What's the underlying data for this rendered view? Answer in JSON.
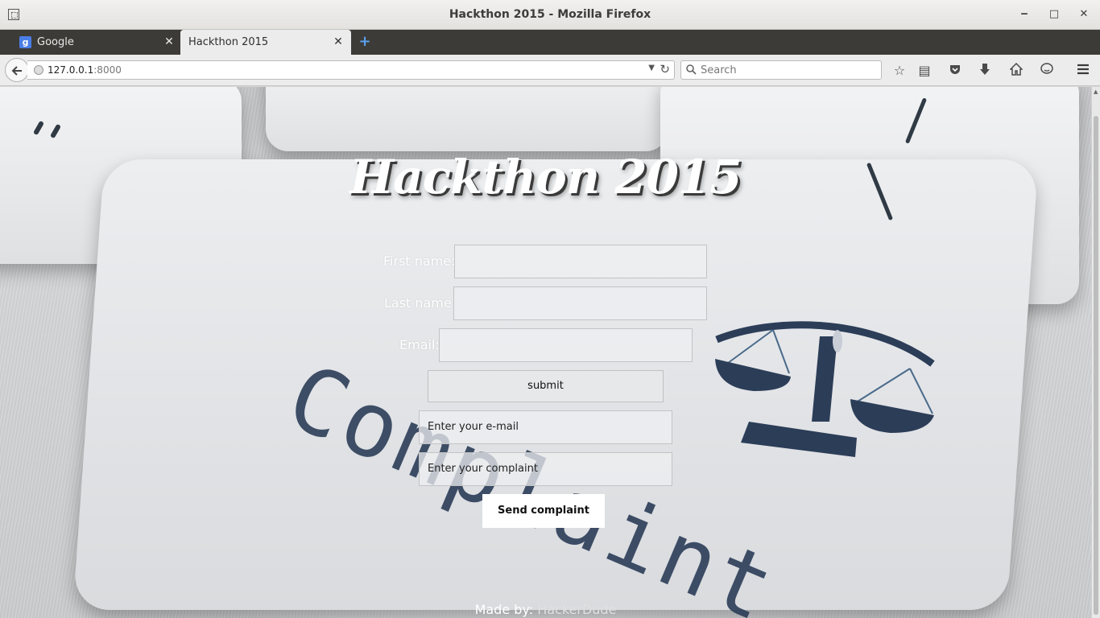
{
  "window": {
    "title": "Hackthon 2015 - Mozilla Firefox",
    "controls": {
      "minimize": "‒",
      "maximize": "□",
      "close": "✕"
    }
  },
  "tabs": [
    {
      "label": "Google",
      "favicon": "google-favicon",
      "favicon_text": "g",
      "active": false
    },
    {
      "label": "Hackthon 2015",
      "active": true
    }
  ],
  "navbar": {
    "url_host": "127.0.0.1",
    "url_port": ":8000",
    "search_placeholder": "Search"
  },
  "page": {
    "heading": "Hackthon 2015",
    "form": {
      "first_name_label": "First name:",
      "last_name_label": "Last name:",
      "email_label": "Email:",
      "submit_label": "submit"
    },
    "complaint": {
      "email_placeholder": "Enter your e-mail",
      "complaint_placeholder": "Enter your complaint",
      "send_label": "Send complaint"
    },
    "footer": {
      "prefix": "Made by: ",
      "author": "HackerDude"
    },
    "background_word": "Complaint"
  },
  "colors": {
    "accent": "#5aa0f0",
    "tabstrip": "#3c3b37",
    "background_ink": "#2c3d58"
  }
}
